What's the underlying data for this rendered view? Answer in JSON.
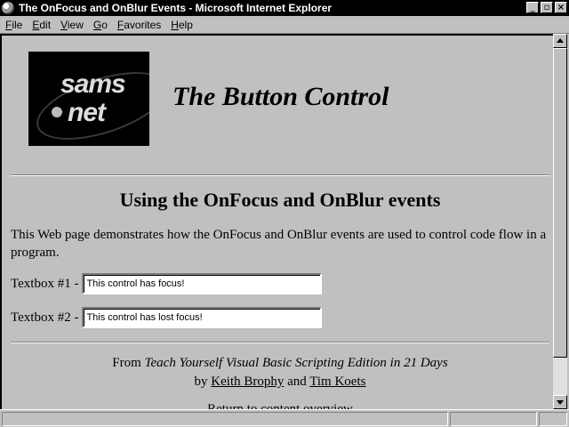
{
  "window": {
    "title": "The OnFocus and OnBlur Events - Microsoft Internet Explorer",
    "icon": "internet-explorer-icon",
    "minimize_glyph": "_",
    "maximize_glyph": "▫",
    "close_glyph": "×"
  },
  "menu": {
    "items": [
      {
        "accel": "F",
        "rest": "ile"
      },
      {
        "accel": "E",
        "rest": "dit"
      },
      {
        "accel": "V",
        "rest": "iew"
      },
      {
        "accel": "G",
        "rest": "o"
      },
      {
        "accel": "F",
        "rest": "avorites"
      },
      {
        "accel": "H",
        "rest": "elp"
      }
    ]
  },
  "page": {
    "logo": {
      "line1": "sams",
      "line2": "net"
    },
    "title": "The Button Control",
    "heading": "Using the OnFocus and OnBlur events",
    "intro": "This Web page demonstrates how the OnFocus and OnBlur events are used to control code flow in a program.",
    "textbox1": {
      "label": "Textbox #1 -",
      "value": "This control has focus!"
    },
    "textbox2": {
      "label": "Textbox #2 -",
      "value": "This control has lost focus!"
    },
    "credit": {
      "from": "From ",
      "book": "Teach Yourself Visual Basic Scripting Edition in 21 Days",
      "by": "by ",
      "author1": "Keith Brophy",
      "and": " and ",
      "author2": "Tim Koets"
    },
    "partial_text": "Return to content overview"
  },
  "colors": {
    "titlebar": "#000000",
    "chrome": "#c0c0c0",
    "textbox_bg": "#ffffff"
  }
}
